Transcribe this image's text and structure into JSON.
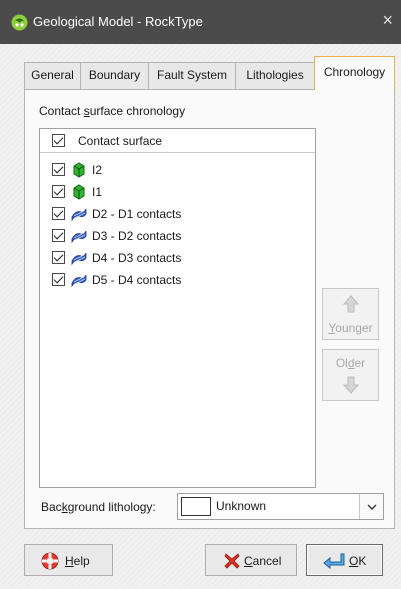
{
  "window": {
    "title": "Geological Model - RockType",
    "close_glyph": "×"
  },
  "tabs": [
    {
      "label": "General",
      "active": false
    },
    {
      "label": "Boundary",
      "active": false
    },
    {
      "label": "Fault System",
      "active": false
    },
    {
      "label": "Lithologies",
      "active": false
    },
    {
      "label": "Chronology",
      "active": true
    }
  ],
  "chronology": {
    "section_label_pre": "Contact ",
    "section_label_mnemonic": "s",
    "section_label_post": "urface chronology",
    "list_header": "Contact surface",
    "header_checked": true,
    "rows": [
      {
        "label": "I2",
        "checked": true,
        "icon": "intrusion-surface-icon"
      },
      {
        "label": "I1",
        "checked": true,
        "icon": "intrusion-surface-icon"
      },
      {
        "label": "D2 - D1 contacts",
        "checked": true,
        "icon": "deposit-contact-icon"
      },
      {
        "label": "D3 - D2 contacts",
        "checked": true,
        "icon": "deposit-contact-icon"
      },
      {
        "label": "D4 - D3 contacts",
        "checked": true,
        "icon": "deposit-contact-icon"
      },
      {
        "label": "D5 - D4 contacts",
        "checked": true,
        "icon": "deposit-contact-icon"
      }
    ],
    "younger_button": {
      "mnemonic": "Y",
      "rest": "ounger",
      "enabled": false
    },
    "older_button": {
      "pre": "Ol",
      "mnemonic": "d",
      "post": "er",
      "enabled": false
    },
    "background_lithology": {
      "label_pre": "Bac",
      "label_mnemonic": "k",
      "label_post": "ground lithology:",
      "value": "Unknown",
      "swatch_color": "#ffffff"
    }
  },
  "buttons": {
    "help": {
      "mnemonic": "H",
      "rest": "elp"
    },
    "cancel": {
      "mnemonic": "C",
      "rest": "ancel"
    },
    "ok": {
      "mnemonic": "O",
      "rest": "K"
    }
  },
  "colors": {
    "titlebar": "#4b4b4b",
    "active_tab_border": "#e8b050",
    "intrusion_green": "#2fb52f",
    "contact_blue": "#3a62c8"
  }
}
